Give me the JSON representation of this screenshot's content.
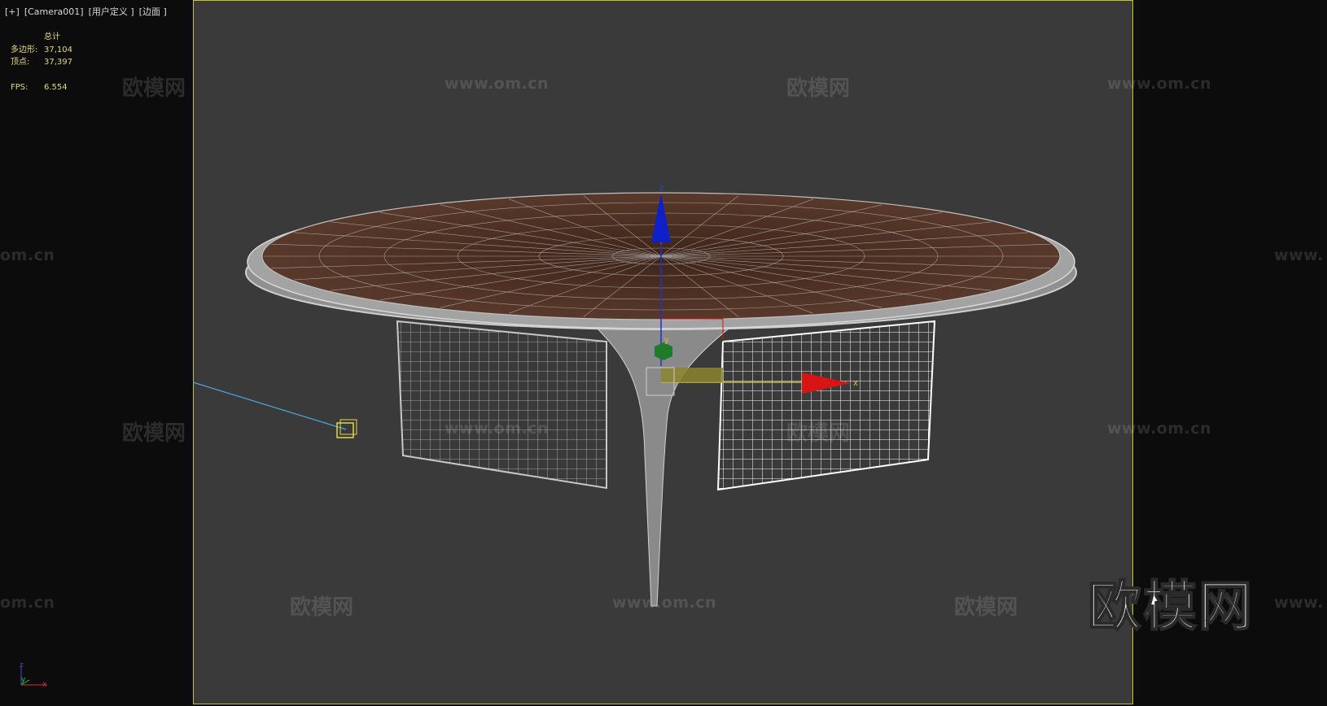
{
  "viewport": {
    "label_plus": "[+]",
    "label_camera": "[Camera001]",
    "label_view": "[用户定义 ]",
    "label_shading": "[边面 ]"
  },
  "stats": {
    "header": "总计",
    "polygons_label": "多边形:",
    "polygons_value": "37,104",
    "vertices_label": "顶点:",
    "vertices_value": "37,397",
    "fps_label": "FPS:",
    "fps_value": "6.554"
  },
  "gizmo": {
    "z_label": "z",
    "y_label": "y",
    "x_label": "x"
  },
  "axis_tripod": {
    "z": "z",
    "y": "y",
    "x": "x"
  },
  "watermarks": {
    "cn": "欧模网",
    "url": "www.om.cn",
    "url_partial": "om.cn",
    "url_partial2": "www."
  },
  "brand_logo": "欧模网",
  "colors": {
    "viewport_bg": "#3a3a3a",
    "safe_frame": "#c9c332",
    "gizmo_x": "#d81414",
    "gizmo_y": "#1f7a2a",
    "gizmo_z": "#1020c8",
    "light_line": "#4aa8e0",
    "table_top": "#4e3328"
  }
}
